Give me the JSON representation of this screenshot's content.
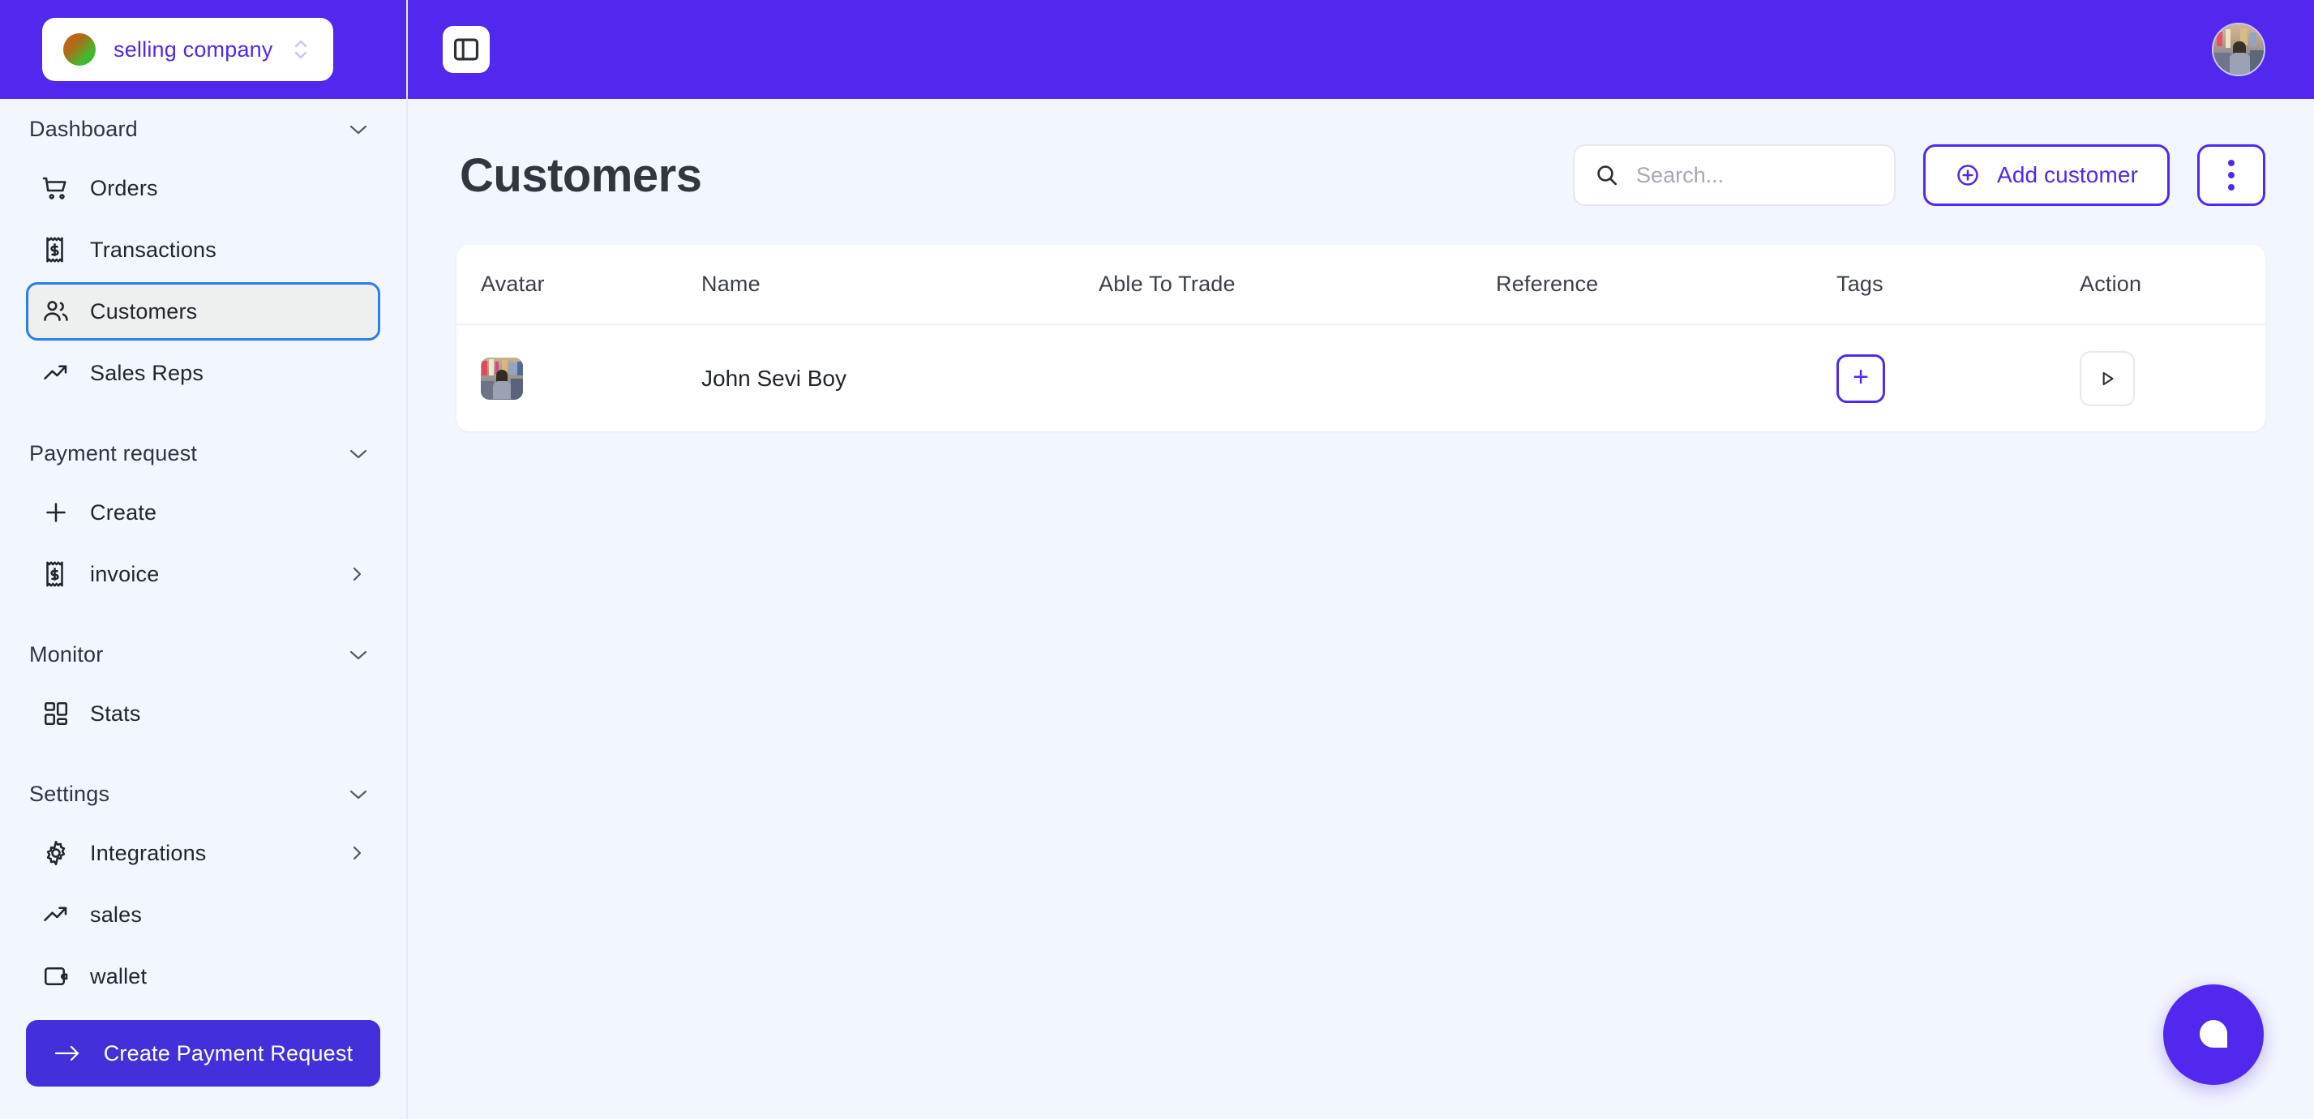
{
  "colors": {
    "brand_purple": "#5228EE",
    "cta_purple": "#4330DA",
    "page_bg": "#F2F6FE",
    "active_ring": "#2F7BF0",
    "card_white": "#FFFFFF",
    "text_dark": "#21262E"
  },
  "sidebar": {
    "org_switcher": {
      "name": "selling company",
      "dot_icon": "org-color-dot",
      "chevron_icon": "chevron-up-down-icon"
    },
    "groups": [
      {
        "label": "Dashboard",
        "chevron_icon": "chevron-down-icon",
        "items": [
          {
            "label": "Orders",
            "icon": "shopping-cart-icon",
            "active": false,
            "submenu": false
          },
          {
            "label": "Transactions",
            "icon": "receipt-dollar-icon",
            "active": false,
            "submenu": false
          },
          {
            "label": "Customers",
            "icon": "users-icon",
            "active": true,
            "submenu": false
          },
          {
            "label": "Sales Reps",
            "icon": "trending-up-icon",
            "active": false,
            "submenu": false
          }
        ]
      },
      {
        "label": "Payment request",
        "chevron_icon": "chevron-down-icon",
        "items": [
          {
            "label": "Create",
            "icon": "plus-icon",
            "active": false,
            "submenu": false
          },
          {
            "label": "invoice",
            "icon": "receipt-dollar-icon",
            "active": false,
            "submenu": true
          }
        ]
      },
      {
        "label": "Monitor",
        "chevron_icon": "chevron-down-icon",
        "items": [
          {
            "label": "Stats",
            "icon": "layout-grid-icon",
            "active": false,
            "submenu": false
          }
        ]
      },
      {
        "label": "Settings",
        "chevron_icon": "chevron-down-icon",
        "items": [
          {
            "label": "Integrations",
            "icon": "gear-icon",
            "active": false,
            "submenu": true
          },
          {
            "label": "sales",
            "icon": "trending-up-icon",
            "active": false,
            "submenu": false
          },
          {
            "label": "wallet",
            "icon": "wallet-icon",
            "active": false,
            "submenu": false
          }
        ]
      }
    ],
    "cta": {
      "label": "Create Payment Request",
      "icon": "arrow-right-icon"
    }
  },
  "topbar": {
    "panel_toggle_icon": "panel-left-icon",
    "avatar_icon": "user-avatar-photo"
  },
  "main": {
    "page_title": "Customers",
    "search": {
      "placeholder": "Search...",
      "value": "",
      "icon": "search-icon"
    },
    "add_customer": {
      "label": "Add customer",
      "icon": "circle-plus-icon"
    },
    "more_menu": {
      "icon": "kebab-menu-icon"
    },
    "table": {
      "columns": [
        "Avatar",
        "Name",
        "Able To Trade",
        "Reference",
        "Tags",
        "Action"
      ],
      "rows": [
        {
          "avatar": "customer-photo",
          "name": "John Sevi Boy",
          "able_to_trade": "",
          "reference": "",
          "tags_add_label": "+",
          "action_icon": "play-icon"
        }
      ]
    }
  },
  "chat_widget": {
    "icon": "chat-bubble-icon"
  }
}
